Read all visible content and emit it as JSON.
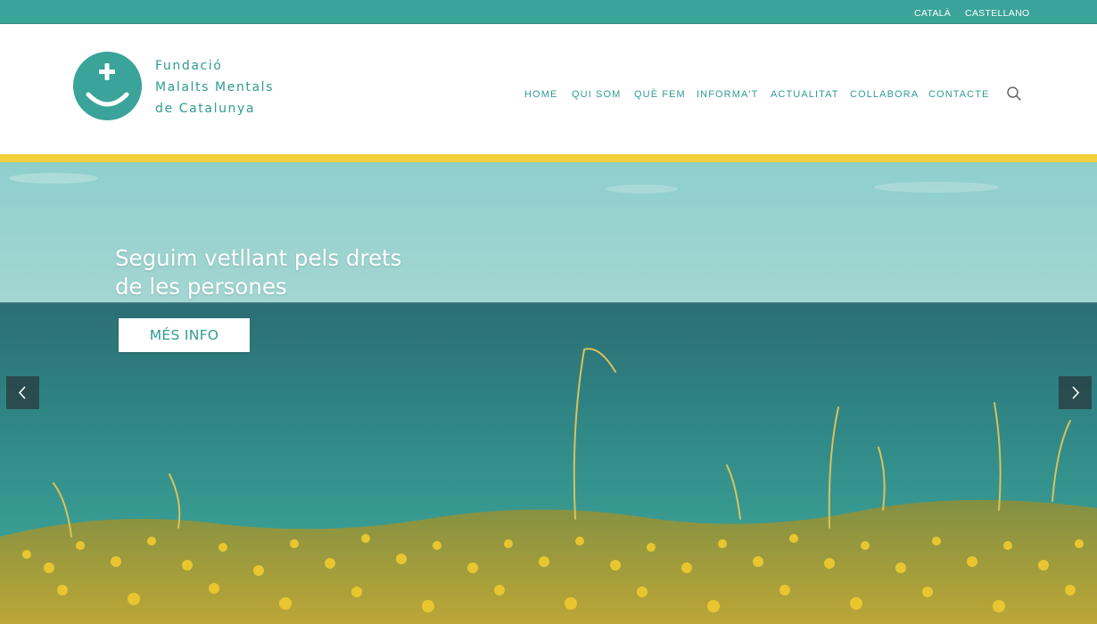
{
  "colors": {
    "accent": "#3aa39a",
    "brand_text": "#2f9c93",
    "yellow_band": "#f2d03b",
    "nav_arrow_bg": "#2d3c40"
  },
  "languages": {
    "catala": "CATALÀ",
    "castellano": "CASTELLANO"
  },
  "logo": {
    "line1": "Fundació",
    "line2": "Malalts Mentals",
    "line3": "de Catalunya"
  },
  "nav": {
    "items": [
      {
        "label": "HOME"
      },
      {
        "label": "QUI SOM"
      },
      {
        "label": "QUÈ FEM"
      },
      {
        "label": "INFORMA'T"
      },
      {
        "label": "ACTUALITAT"
      },
      {
        "label": "COLLABORA"
      },
      {
        "label": "CONTACTE"
      }
    ],
    "search_icon": "search-icon"
  },
  "hero": {
    "headline_line1": "Seguim vetllant pels drets",
    "headline_line2": "de les persones",
    "button_label": "MÉS INFO",
    "prev_icon": "chevron-left-icon",
    "next_icon": "chevron-right-icon"
  }
}
